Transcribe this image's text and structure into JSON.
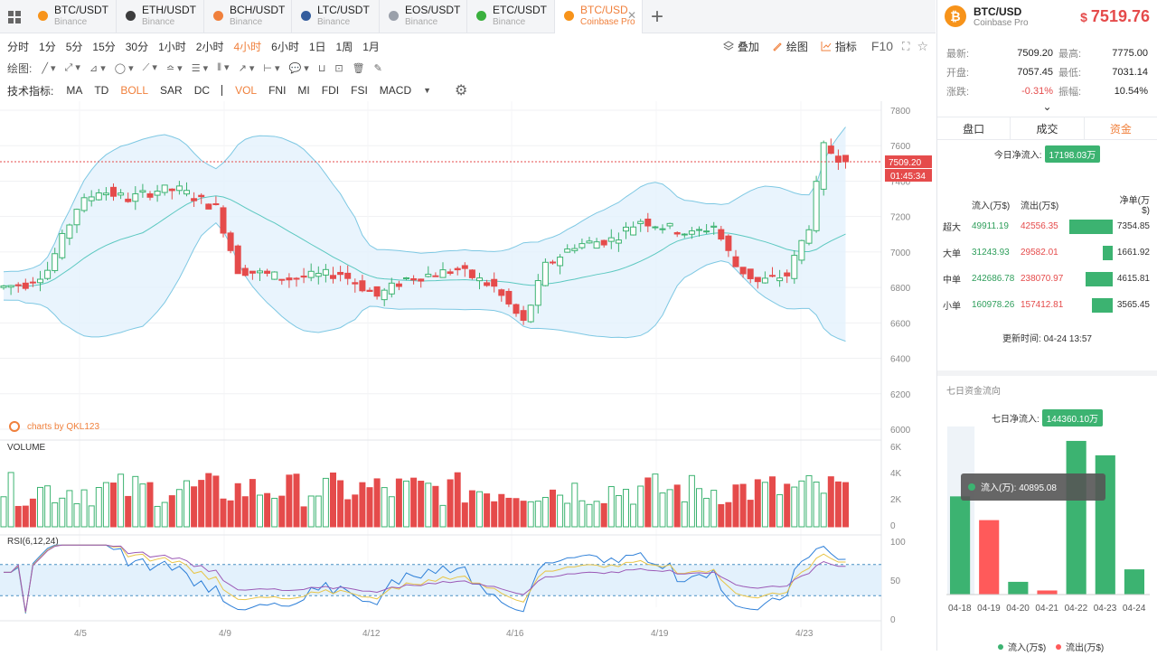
{
  "tabs": [
    {
      "symbol": "BTC/USDT",
      "exchange": "Binance",
      "color": "#f7931a",
      "active": false
    },
    {
      "symbol": "ETH/USDT",
      "exchange": "Binance",
      "color": "#3c3c3d",
      "active": false
    },
    {
      "symbol": "BCH/USDT",
      "exchange": "Binance",
      "color": "#f0803c",
      "active": false
    },
    {
      "symbol": "LTC/USDT",
      "exchange": "Binance",
      "color": "#345d9d",
      "active": false
    },
    {
      "symbol": "EOS/USDT",
      "exchange": "Binance",
      "color": "#9aa0aa",
      "active": false
    },
    {
      "symbol": "ETC/USDT",
      "exchange": "Binance",
      "color": "#3ab03e",
      "active": false
    },
    {
      "symbol": "BTC/USD",
      "exchange": "Coinbase Pro",
      "color": "#f7931a",
      "active": true
    }
  ],
  "timeframes": [
    "分时",
    "1分",
    "5分",
    "15分",
    "30分",
    "1小时",
    "2小时",
    "4小时",
    "6小时",
    "1日",
    "1周",
    "1月"
  ],
  "active_timeframe": "4小时",
  "tools_right": {
    "overlay": "叠加",
    "draw": "绘图",
    "indicator": "指标",
    "f10": "F10"
  },
  "draw_label": "绘图:",
  "indicator_label": "技术指标:",
  "indicators_main": [
    "MA",
    "TD",
    "BOLL",
    "SAR",
    "DC"
  ],
  "indicators_sub": [
    "VOL",
    "FNI",
    "MI",
    "FDI",
    "FSI",
    "MACD"
  ],
  "active_indicators": [
    "BOLL",
    "VOL"
  ],
  "chart": {
    "price_axis": [
      "7800",
      "7600",
      "7400",
      "7200",
      "7000",
      "6800",
      "6600",
      "6400",
      "6200",
      "6000"
    ],
    "price_range": [
      6000,
      7800
    ],
    "last_price": "7509.20",
    "countdown": "01:45:34",
    "watermark": "charts by QKL123",
    "volume_label": "VOLUME",
    "volume_axis": [
      "6K",
      "4K",
      "2K",
      "0"
    ],
    "rsi_label": "RSI(6,12,24)",
    "rsi_axis": [
      "100",
      "50",
      "0"
    ],
    "x_labels": [
      "4/5",
      "4/9",
      "4/12",
      "4/16",
      "4/19",
      "4/23"
    ],
    "colors": {
      "up": "#3cb371",
      "down": "#e54b4b",
      "boll": "#7ec8e3",
      "boll_fill": "#e3f1fc"
    }
  },
  "sidebar": {
    "pair": "BTC/USD",
    "exchange": "Coinbase Pro",
    "currency": "$",
    "price": "7519.76",
    "stats": [
      {
        "k": "最新:",
        "v": "7509.20",
        "k2": "最高:",
        "v2": "7775.00"
      },
      {
        "k": "开盘:",
        "v": "7057.45",
        "k2": "最低:",
        "v2": "7031.14"
      },
      {
        "k": "涨跌:",
        "v": "-0.31%",
        "k2": "振幅:",
        "v2": "10.54%"
      }
    ],
    "tabs": [
      "盘口",
      "成交",
      "资金"
    ],
    "active_tab": "资金",
    "today_net_label": "今日净流入:",
    "today_net_value": "17198.03万",
    "flow_headers": [
      "",
      "流入(万$)",
      "流出(万$)",
      "",
      "净单(万$)"
    ],
    "flow_rows": [
      {
        "name": "超大",
        "in": "49911.19",
        "out": "42556.35",
        "net": "7354.85",
        "netval": 7354.85
      },
      {
        "name": "大单",
        "in": "31243.93",
        "out": "29582.01",
        "net": "1661.92",
        "netval": 1661.92
      },
      {
        "name": "中单",
        "in": "242686.78",
        "out": "238070.97",
        "net": "4615.81",
        "netval": 4615.81
      },
      {
        "name": "小单",
        "in": "160978.26",
        "out": "157412.81",
        "net": "3565.45",
        "netval": 3565.45
      }
    ],
    "updated_label": "更新时间:",
    "updated_value": "04-24 13:57",
    "seven_title": "七日资金流向",
    "seven_net_label": "七日净流入:",
    "seven_net_value": "144360.10万",
    "legend_in": "流入(万$)",
    "legend_out": "流出(万$)",
    "tooltip": "流入(万): 40895.08"
  },
  "chart_data": {
    "type": "bar",
    "title": "七日资金流向",
    "categories": [
      "04-18",
      "04-19",
      "04-20",
      "04-21",
      "04-22",
      "04-23",
      "04-24"
    ],
    "series": [
      {
        "name": "流入(万$)",
        "values": [
          40895.08,
          null,
          5300,
          null,
          64000,
          58000,
          10500
        ]
      },
      {
        "name": "流出(万$)",
        "values": [
          null,
          31000,
          null,
          1700,
          null,
          null,
          null
        ]
      }
    ],
    "colors": {
      "流入(万$)": "#3cb371",
      "流出(万$)": "#ff5a5a"
    },
    "highlighted": "04-18"
  }
}
